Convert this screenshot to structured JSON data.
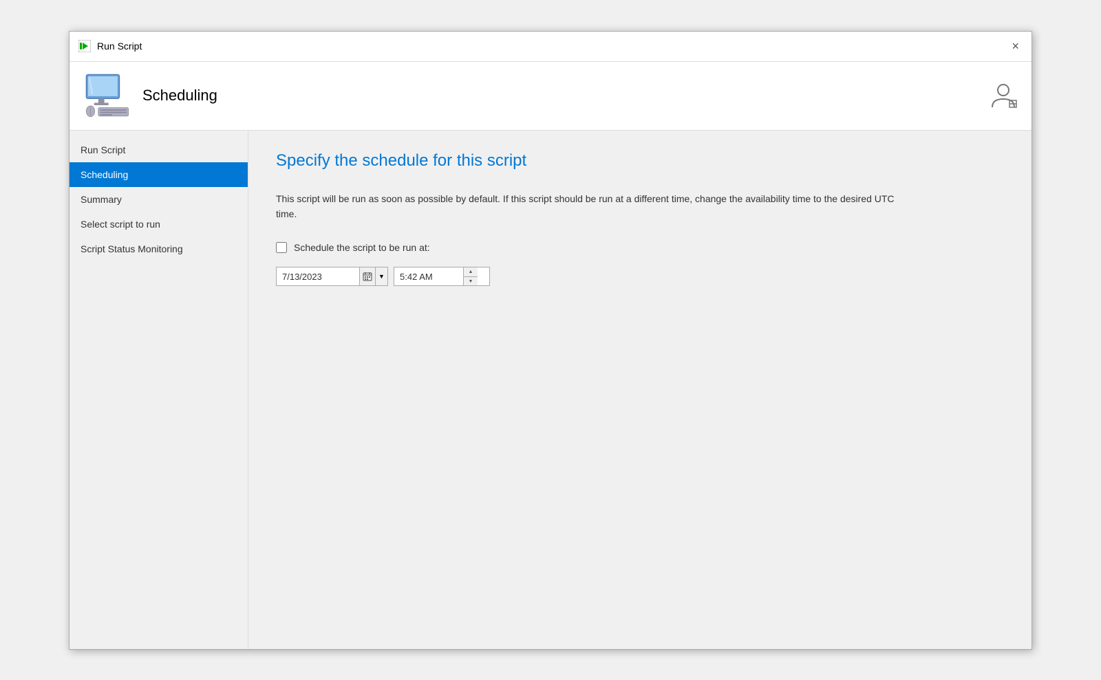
{
  "titleBar": {
    "title": "Run Script",
    "closeLabel": "×"
  },
  "header": {
    "title": "Scheduling"
  },
  "sidebar": {
    "items": [
      {
        "id": "run-script",
        "label": "Run Script",
        "active": false
      },
      {
        "id": "scheduling",
        "label": "Scheduling",
        "active": true
      },
      {
        "id": "summary",
        "label": "Summary",
        "active": false
      },
      {
        "id": "select-script",
        "label": "Select script to run",
        "active": false
      },
      {
        "id": "script-status",
        "label": "Script Status Monitoring",
        "active": false
      }
    ]
  },
  "content": {
    "title": "Specify the schedule for this script",
    "description": "This script will be run as soon as possible by default. If this script should be run at a different time, change the availability time to the desired UTC time.",
    "checkboxLabel": "Schedule the script to be run at:",
    "dateValue": "7/13/2023",
    "timeValue": "5:42 AM"
  }
}
